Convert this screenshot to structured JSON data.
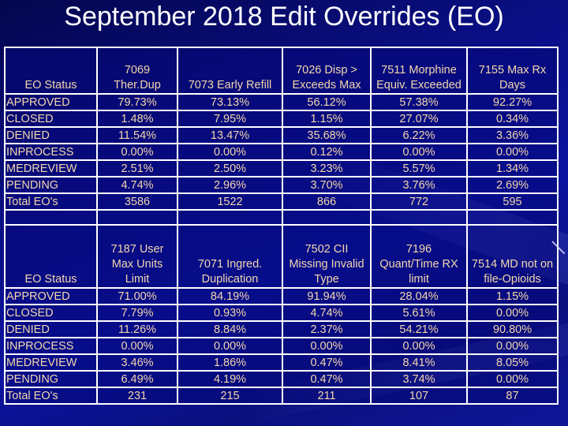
{
  "title": "September 2018 Edit Overrides (EO)",
  "tables": [
    {
      "status_header": "EO Status",
      "columns": [
        [
          "7069",
          "Ther.Dup"
        ],
        [
          "7073 Early Refill"
        ],
        [
          "7026 Disp >",
          "Exceeds Max"
        ],
        [
          "7511 Morphine",
          "Equiv. Exceeded"
        ],
        [
          "7155 Max Rx",
          "Days"
        ]
      ],
      "rows": [
        {
          "label": "APPROVED",
          "values": [
            "79.73%",
            "73.13%",
            "56.12%",
            "57.38%",
            "92.27%"
          ]
        },
        {
          "label": "CLOSED",
          "values": [
            "1.48%",
            "7.95%",
            "1.15%",
            "27.07%",
            "0.34%"
          ]
        },
        {
          "label": "DENIED",
          "values": [
            "11.54%",
            "13.47%",
            "35.68%",
            "6.22%",
            "3.36%"
          ]
        },
        {
          "label": "INPROCESS",
          "values": [
            "0.00%",
            "0.00%",
            "0.12%",
            "0.00%",
            "0.00%"
          ]
        },
        {
          "label": "MEDREVIEW",
          "values": [
            "2.51%",
            "2.50%",
            "3.23%",
            "5.57%",
            "1.34%"
          ]
        },
        {
          "label": "PENDING",
          "values": [
            "4.74%",
            "2.96%",
            "3.70%",
            "3.76%",
            "2.69%"
          ]
        },
        {
          "label": "Total EO's",
          "values": [
            "3586",
            "1522",
            "866",
            "772",
            "595"
          ]
        }
      ]
    },
    {
      "status_header": "EO Status",
      "columns": [
        [
          "7187 User",
          "Max Units",
          "Limit"
        ],
        [
          "7071 Ingred.",
          "Duplication"
        ],
        [
          "7502 CII",
          "Missing Invalid",
          "Type"
        ],
        [
          "7196",
          "Quant/Time RX",
          "limit"
        ],
        [
          "7514 MD not on",
          "file-Opioids"
        ]
      ],
      "rows": [
        {
          "label": "APPROVED",
          "values": [
            "71.00%",
            "84.19%",
            "91.94%",
            "28.04%",
            "1.15%"
          ]
        },
        {
          "label": "CLOSED",
          "values": [
            "7.79%",
            "0.93%",
            "4.74%",
            "5.61%",
            "0.00%"
          ]
        },
        {
          "label": "DENIED",
          "values": [
            "11.26%",
            "8.84%",
            "2.37%",
            "54.21%",
            "90.80%"
          ]
        },
        {
          "label": "INPROCESS",
          "values": [
            "0.00%",
            "0.00%",
            "0.00%",
            "0.00%",
            "0.00%"
          ]
        },
        {
          "label": "MEDREVIEW",
          "values": [
            "3.46%",
            "1.86%",
            "0.47%",
            "8.41%",
            "8.05%"
          ]
        },
        {
          "label": "PENDING",
          "values": [
            "6.49%",
            "4.19%",
            "0.47%",
            "3.74%",
            "0.00%"
          ]
        },
        {
          "label": "Total EO's",
          "values": [
            "231",
            "215",
            "211",
            "107",
            "87"
          ]
        }
      ]
    }
  ],
  "colors": {
    "background": "#0a0f86",
    "text": "#f3d7ad",
    "title": "#ffffff",
    "grid": "#ffffff"
  }
}
